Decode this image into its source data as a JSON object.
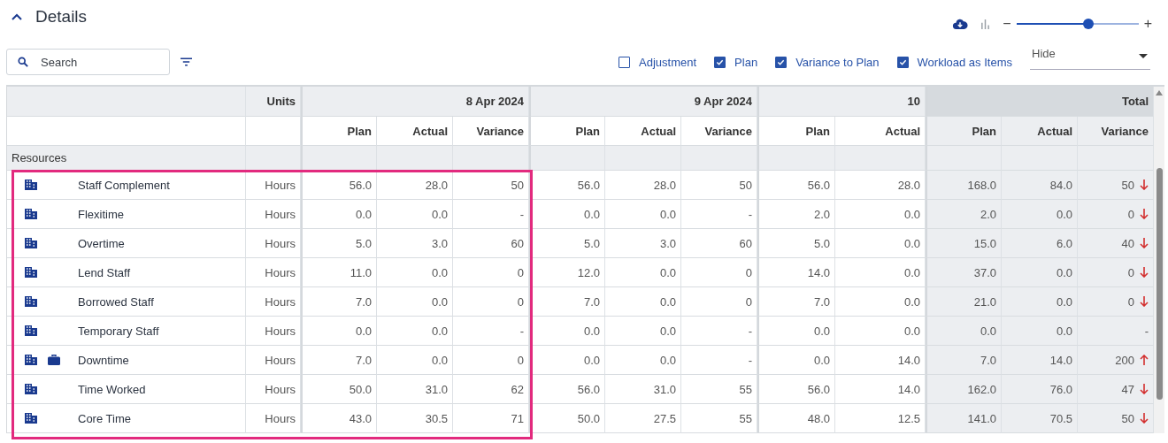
{
  "section": {
    "title": "Details",
    "expanded": true
  },
  "toolbar": {
    "zoom": {
      "level": 0.59,
      "minus": "−",
      "plus": "+"
    }
  },
  "search": {
    "placeholder": "Search"
  },
  "options": [
    {
      "label": "Adjustment",
      "checked": false
    },
    {
      "label": "Plan",
      "checked": true
    },
    {
      "label": "Variance to Plan",
      "checked": true
    },
    {
      "label": "Workload as Items",
      "checked": true
    }
  ],
  "dropdown": {
    "value": "Hide"
  },
  "table": {
    "units_header": "Units",
    "days": [
      {
        "date": "8 Apr 2024",
        "columns": [
          "Plan",
          "Actual",
          "Variance"
        ]
      },
      {
        "date": "9 Apr 2024",
        "columns": [
          "Plan",
          "Actual",
          "Variance"
        ]
      },
      {
        "date": "10",
        "columns": [
          "Plan",
          "Actual"
        ]
      }
    ],
    "total": {
      "label": "Total",
      "columns": [
        "Plan",
        "Actual",
        "Variance"
      ]
    },
    "group": "Resources",
    "rows": [
      {
        "name": "Staff Complement",
        "briefcase": false,
        "units": "Hours",
        "days": [
          [
            "56.0",
            "28.0",
            "50"
          ],
          [
            "56.0",
            "28.0",
            "50"
          ],
          [
            "56.0",
            "28.0"
          ]
        ],
        "total": [
          "168.0",
          "84.0",
          "50"
        ],
        "trend_up": false
      },
      {
        "name": "Flexitime",
        "briefcase": false,
        "units": "Hours",
        "days": [
          [
            "0.0",
            "0.0",
            "-"
          ],
          [
            "0.0",
            "0.0",
            "-"
          ],
          [
            "2.0",
            "0.0"
          ]
        ],
        "total": [
          "2.0",
          "0.0",
          "0"
        ],
        "trend_up": false
      },
      {
        "name": "Overtime",
        "briefcase": false,
        "units": "Hours",
        "days": [
          [
            "5.0",
            "3.0",
            "60"
          ],
          [
            "5.0",
            "3.0",
            "60"
          ],
          [
            "5.0",
            "0.0"
          ]
        ],
        "total": [
          "15.0",
          "6.0",
          "40"
        ],
        "trend_up": false
      },
      {
        "name": "Lend Staff",
        "briefcase": false,
        "units": "Hours",
        "days": [
          [
            "11.0",
            "0.0",
            "0"
          ],
          [
            "12.0",
            "0.0",
            "0"
          ],
          [
            "14.0",
            "0.0"
          ]
        ],
        "total": [
          "37.0",
          "0.0",
          "0"
        ],
        "trend_up": false
      },
      {
        "name": "Borrowed Staff",
        "briefcase": false,
        "units": "Hours",
        "days": [
          [
            "7.0",
            "0.0",
            "0"
          ],
          [
            "7.0",
            "0.0",
            "0"
          ],
          [
            "7.0",
            "0.0"
          ]
        ],
        "total": [
          "21.0",
          "0.0",
          "0"
        ],
        "trend_up": false
      },
      {
        "name": "Temporary Staff",
        "briefcase": false,
        "units": "Hours",
        "days": [
          [
            "0.0",
            "0.0",
            "-"
          ],
          [
            "0.0",
            "0.0",
            "-"
          ],
          [
            "0.0",
            "0.0"
          ]
        ],
        "total": [
          "0.0",
          "0.0",
          "-"
        ]
      },
      {
        "name": "Downtime",
        "briefcase": true,
        "units": "Hours",
        "days": [
          [
            "7.0",
            "0.0",
            "0"
          ],
          [
            "0.0",
            "0.0",
            "-"
          ],
          [
            "0.0",
            "14.0"
          ]
        ],
        "total": [
          "7.0",
          "14.0",
          "200"
        ],
        "trend_up": true
      },
      {
        "name": "Time Worked",
        "briefcase": false,
        "units": "Hours",
        "days": [
          [
            "50.0",
            "31.0",
            "62"
          ],
          [
            "56.0",
            "31.0",
            "55"
          ],
          [
            "56.0",
            "14.0"
          ]
        ],
        "total": [
          "162.0",
          "76.0",
          "47"
        ],
        "trend_up": false
      },
      {
        "name": "Core Time",
        "briefcase": false,
        "units": "Hours",
        "days": [
          [
            "43.0",
            "30.5",
            "71"
          ],
          [
            "50.0",
            "27.5",
            "55"
          ],
          [
            "48.0",
            "12.5"
          ]
        ],
        "total": [
          "141.0",
          "70.5",
          "50"
        ],
        "trend_up": false
      }
    ]
  }
}
